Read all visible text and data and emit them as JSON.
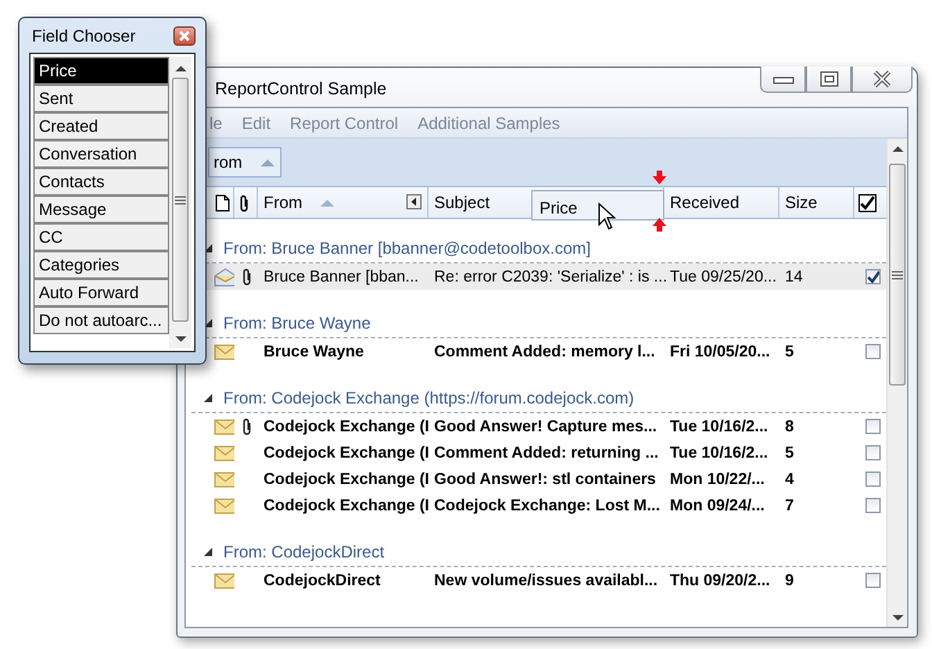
{
  "field_chooser": {
    "title": "Field Chooser",
    "items": [
      {
        "label": "Price",
        "selected": true
      },
      {
        "label": "Sent",
        "selected": false
      },
      {
        "label": "Created",
        "selected": false
      },
      {
        "label": "Conversation",
        "selected": false
      },
      {
        "label": "Contacts",
        "selected": false
      },
      {
        "label": "Message",
        "selected": false
      },
      {
        "label": "CC",
        "selected": false
      },
      {
        "label": "Categories",
        "selected": false
      },
      {
        "label": "Auto Forward",
        "selected": false
      },
      {
        "label": "Do not autoarc...",
        "selected": false
      }
    ]
  },
  "window": {
    "title": "ReportControl Sample"
  },
  "menu": [
    "le",
    "Edit",
    "Report Control",
    "Additional Samples"
  ],
  "group_by": {
    "label": "rom"
  },
  "columns": [
    {
      "kind": "icon"
    },
    {
      "kind": "attachment"
    },
    {
      "kind": "sort",
      "label": "From"
    },
    {
      "kind": "scroll",
      "label": "Subject"
    },
    {
      "kind": "text",
      "label": "Received"
    },
    {
      "kind": "text",
      "label": "Size"
    },
    {
      "kind": "checkbox",
      "checked": true
    }
  ],
  "drag": {
    "label": "Price"
  },
  "groups": [
    {
      "title": "From: Bruce Banner [bbanner@codetoolbox.com]",
      "expanded": true,
      "rows": [
        {
          "read": true,
          "attachment": true,
          "selected": true,
          "checked": true,
          "from": "Bruce Banner [bban...",
          "subject": "Re: error C2039: 'Serialize' : is ...",
          "received": "Tue 09/25/20...",
          "size": "14"
        }
      ]
    },
    {
      "title": "From: Bruce Wayne",
      "expanded": true,
      "rows": [
        {
          "read": false,
          "attachment": false,
          "selected": false,
          "checked": false,
          "from": "Bruce Wayne",
          "subject": "Comment Added: memory l...",
          "received": "Fri 10/05/20...",
          "size": "5"
        }
      ]
    },
    {
      "title": "From: Codejock Exchange (https://forum.codejock.com)",
      "expanded": true,
      "rows": [
        {
          "read": false,
          "attachment": true,
          "selected": false,
          "checked": false,
          "from": "Codejock Exchange (I",
          "subject": "Good Answer! Capture mes...",
          "received": "Tue 10/16/2...",
          "size": "8"
        },
        {
          "read": false,
          "attachment": false,
          "selected": false,
          "checked": false,
          "from": "Codejock Exchange (I",
          "subject": "Comment Added: returning ...",
          "received": "Tue 10/16/2...",
          "size": "5"
        },
        {
          "read": false,
          "attachment": false,
          "selected": false,
          "checked": false,
          "from": "Codejock Exchange (I",
          "subject": "Good Answer!: stl containers",
          "received": "Mon 10/22/...",
          "size": "4"
        },
        {
          "read": false,
          "attachment": false,
          "selected": false,
          "checked": false,
          "from": "Codejock Exchange (I",
          "subject": "Codejock Exchange:  Lost M...",
          "received": "Mon 09/24/...",
          "size": "7"
        }
      ]
    },
    {
      "title": "From: CodejockDirect",
      "expanded": true,
      "rows": [
        {
          "read": false,
          "attachment": false,
          "selected": false,
          "checked": false,
          "from": "CodejockDirect",
          "subject": "New volume/issues availabl...",
          "received": "Thu 09/20/2...",
          "size": "9"
        }
      ]
    }
  ]
}
